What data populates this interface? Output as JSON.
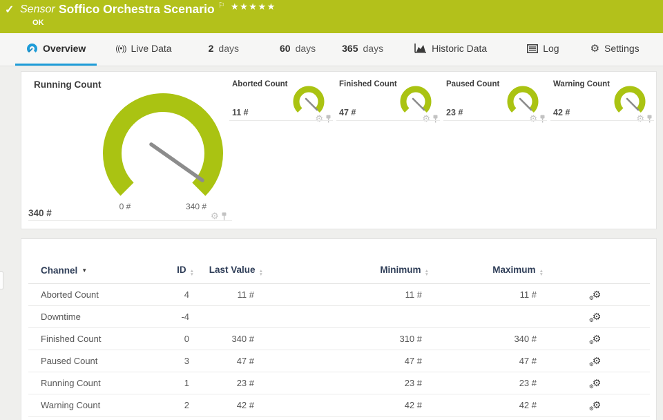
{
  "header": {
    "status_check": "✓",
    "kind_label": "Sensor",
    "title": "Soffico Orchestra Scenario",
    "status_text": "OK",
    "stars": "★★★★★"
  },
  "tabs": {
    "overview": "Overview",
    "live_data": "Live Data",
    "d2_num": "2",
    "d2_unit": "days",
    "d60_num": "60",
    "d60_unit": "days",
    "d365_num": "365",
    "d365_unit": "days",
    "historic": "Historic Data",
    "log": "Log",
    "settings": "Settings",
    "live_icon_glyph": "((•))"
  },
  "gauges": {
    "main": {
      "title": "Running Count",
      "value": "340 #",
      "scale_min": "0 #",
      "scale_max": "340 #"
    },
    "small": [
      {
        "title": "Aborted Count",
        "value": "11 #"
      },
      {
        "title": "Finished Count",
        "value": "47 #"
      },
      {
        "title": "Paused Count",
        "value": "23 #"
      },
      {
        "title": "Warning Count",
        "value": "42 #"
      }
    ]
  },
  "table": {
    "headers": {
      "channel": "Channel",
      "id": "ID",
      "last": "Last Value",
      "min": "Minimum",
      "max": "Maximum"
    },
    "rows": [
      {
        "channel": "Aborted Count",
        "id": "4",
        "last": "11 #",
        "min": "11 #",
        "max": "11 #"
      },
      {
        "channel": "Downtime",
        "id": "-4",
        "last": "",
        "min": "",
        "max": ""
      },
      {
        "channel": "Finished Count",
        "id": "0",
        "last": "340 #",
        "min": "310 #",
        "max": "340 #"
      },
      {
        "channel": "Paused Count",
        "id": "3",
        "last": "47 #",
        "min": "47 #",
        "max": "47 #"
      },
      {
        "channel": "Running Count",
        "id": "1",
        "last": "23 #",
        "min": "23 #",
        "max": "23 #"
      },
      {
        "channel": "Warning Count",
        "id": "2",
        "last": "42 #",
        "min": "42 #",
        "max": "42 #"
      }
    ]
  },
  "colors": {
    "brand_green": "#b3c11b",
    "gauge_green": "#aac312",
    "active_tab_blue": "#1e9cd8",
    "table_header_navy": "#2f3e58"
  }
}
